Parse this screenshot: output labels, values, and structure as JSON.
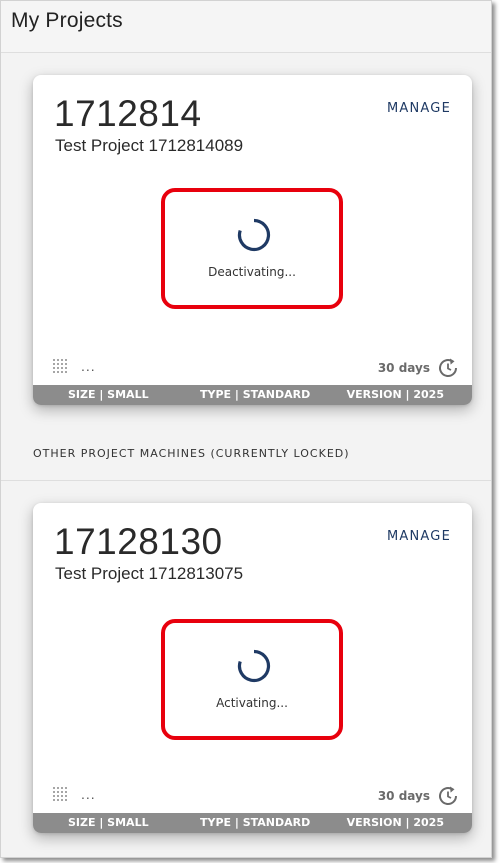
{
  "header": {
    "title": "My Projects"
  },
  "section_label": "OTHER PROJECT MACHINES (CURRENTLY LOCKED)",
  "cards": [
    {
      "id": "1712814",
      "name": "Test Project 1712814089",
      "manage_label": "MANAGE",
      "status": "Deactivating...",
      "menu_dots": "...",
      "days": "30 days",
      "size": "SIZE | SMALL",
      "type": "TYPE | STANDARD",
      "version": "VERSION | 2025"
    },
    {
      "id": "17128130",
      "name": "Test Project 1712813075",
      "manage_label": "MANAGE",
      "status": "Activating...",
      "menu_dots": "...",
      "days": "30 days",
      "size": "SIZE | SMALL",
      "type": "TYPE | STANDARD",
      "version": "VERSION | 2025"
    }
  ],
  "icons": {
    "spinner": "loading-spinner-icon",
    "grid": "grid-dots-icon",
    "renew": "renew-clock-icon"
  },
  "colors": {
    "highlight": "#e8000d",
    "accent": "#1f3a64",
    "footer": "#8c8c8c"
  }
}
